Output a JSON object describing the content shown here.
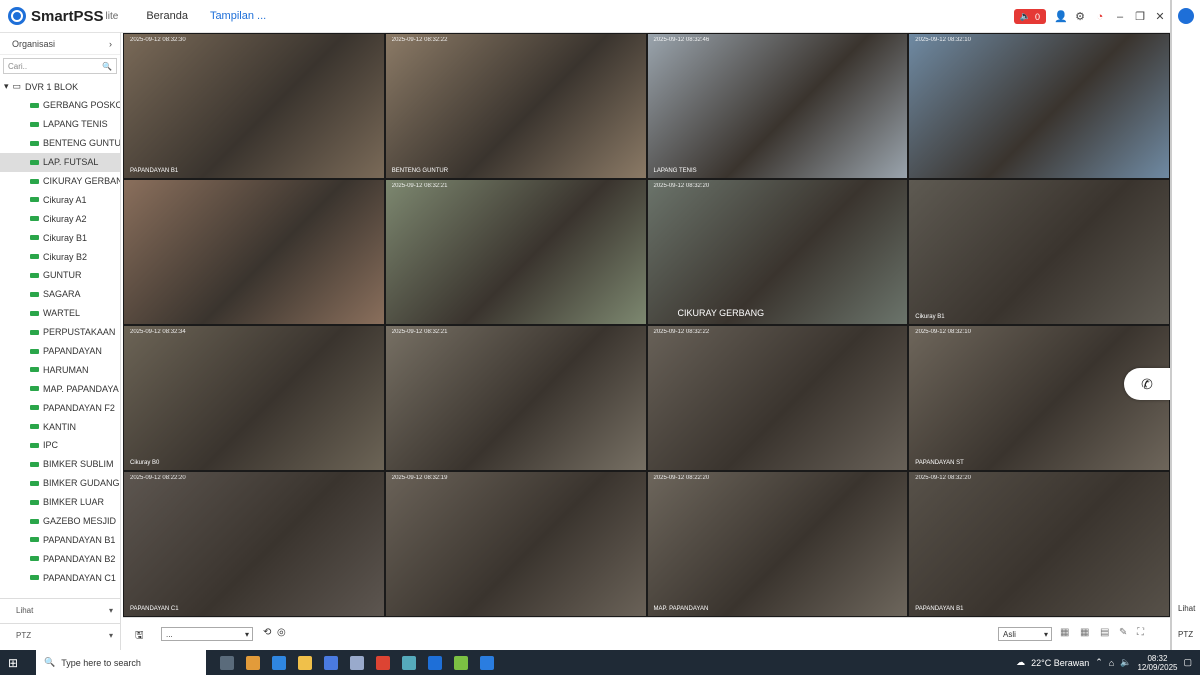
{
  "app": {
    "name": "SmartPSS",
    "name_sup": "lite",
    "nav": [
      "Beranda",
      "Tampilan ..."
    ],
    "alarm_count": "0"
  },
  "sidebar": {
    "header": "Organisasi",
    "search_placeholder": "Cari..",
    "root": "DVR 1 BLOK",
    "items": [
      "GERBANG POSKO",
      "LAPANG TENIS",
      "BENTENG GUNTU",
      "LAP. FUTSAL",
      "CIKURAY GERBAN",
      "Cikuray A1",
      "Cikuray A2",
      "Cikuray  B1",
      "Cikuray B2",
      "GUNTUR",
      "SAGARA",
      "WARTEL",
      "PERPUSTAKAAN",
      "PAPANDAYAN",
      "HARUMAN",
      "MAP. PAPANDAYA",
      "PAPANDAYAN F2",
      "KANTIN",
      "IPC",
      "BIMKER SUBLIM",
      "BIMKER GUDANG",
      "BIMKER LUAR",
      "GAZEBO MESJID",
      "PAPANDAYAN B1",
      "PAPANDAYAN B2",
      "PAPANDAYAN C1"
    ],
    "selected_index": 3,
    "footer": [
      "Lihat",
      "PTZ"
    ]
  },
  "tiles": [
    {
      "ts": "2025-09-12 08:32:30",
      "label": "PAPANDAYAN B1",
      "bg": "#7a6a58"
    },
    {
      "ts": "2025-09-12 08:32:22",
      "label": "BENTENG GUNTUR",
      "bg": "#8b7a66"
    },
    {
      "ts": "2025-09-12 08:32:46",
      "label": "LAPANG TENIS",
      "bg": "#9aa4ad"
    },
    {
      "ts": "2025-09-12 08:32:10",
      "label": "",
      "bg": "#6f8aa3"
    },
    {
      "ts": "",
      "label": "",
      "bg": "#8a6f5c"
    },
    {
      "ts": "2025-09-12 08:32:21",
      "label": "",
      "bg": "#7d8870"
    },
    {
      "ts": "2025-09-12 08:32:20",
      "label": "CIKURAY GERBANG",
      "bg": "#6b746b"
    },
    {
      "ts": "",
      "label": "Cikuray  B1",
      "bg": "#5e5a52"
    },
    {
      "ts": "2025-09-12 08:32:34",
      "label": "Cikuray B0",
      "bg": "#6c6456"
    },
    {
      "ts": "2025-09-12 08:32:21",
      "label": "",
      "bg": "#777064"
    },
    {
      "ts": "2025-09-12 08:32:22",
      "label": "",
      "bg": "#686158"
    },
    {
      "ts": "2025-09-12 08:32:10",
      "label": "PAPANDAYAN ST",
      "bg": "#6e665b"
    },
    {
      "ts": "2025-09-12 08:22:20",
      "label": "PAPANDAYAN C1",
      "bg": "#5d5650"
    },
    {
      "ts": "2025-09-12 08:32:19",
      "label": "",
      "bg": "#6a6258"
    },
    {
      "ts": "2025-09-12 08:22:20",
      "label": "MAP. PAPANDAYAN",
      "bg": "#6d665c"
    },
    {
      "ts": "2025-09-12 08:32:20",
      "label": "PAPANDAYAN B1",
      "bg": "#575149"
    }
  ],
  "bottombar": {
    "layout_select": "...",
    "aspect": "Asli"
  },
  "taskbar": {
    "search": "Type here to search",
    "weather": "22°C  Berawan",
    "time": "08:32",
    "date": "12/09/2025"
  },
  "rightpane": {
    "labels": [
      "Lihat",
      "PTZ"
    ]
  }
}
